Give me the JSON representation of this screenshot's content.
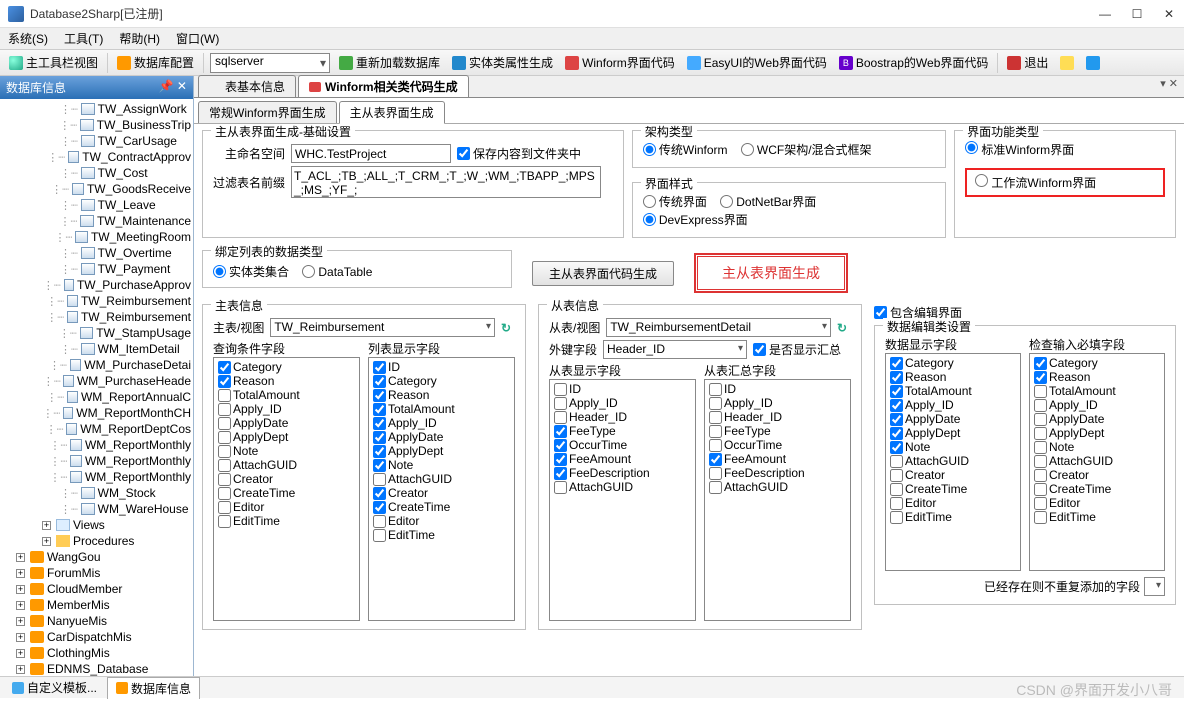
{
  "window": {
    "title": "Database2Sharp[已注册]"
  },
  "menu": {
    "system": "系统(S)",
    "tools": "工具(T)",
    "help": "帮助(H)",
    "window": "窗口(W)"
  },
  "toolbar": {
    "main_toolbar": "主工具栏视图",
    "db_config": "数据库配置",
    "db_select": "sqlserver",
    "reload": "重新加载数据库",
    "entity_attr": "实体类属性生成",
    "winform_code": "Winform界面代码",
    "easyui": "EasyUI的Web界面代码",
    "bootstrap": "Boostrap的Web界面代码",
    "exit": "退出"
  },
  "left": {
    "title": "数据库信息",
    "tables": [
      "TW_AssignWork",
      "TW_BusinessTrip",
      "TW_CarUsage",
      "TW_ContractApprov",
      "TW_Cost",
      "TW_GoodsReceive",
      "TW_Leave",
      "TW_Maintenance",
      "TW_MeetingRoom",
      "TW_Overtime",
      "TW_Payment",
      "TW_PurchaseApprov",
      "TW_Reimbursement",
      "TW_Reimbursement",
      "TW_StampUsage",
      "WM_ItemDetail",
      "WM_PurchaseDetai",
      "WM_PurchaseHeade",
      "WM_ReportAnnualC",
      "WM_ReportMonthCH",
      "WM_ReportDeptCos",
      "WM_ReportMonthly",
      "WM_ReportMonthly",
      "WM_ReportMonthly",
      "WM_Stock",
      "WM_WareHouse"
    ],
    "views": "Views",
    "procedures": "Procedures",
    "dbs": [
      "WangGou",
      "ForumMis",
      "CloudMember",
      "MemberMis",
      "NanyueMis",
      "CarDispatchMis",
      "ClothingMis",
      "EDNMS_Database"
    ]
  },
  "tabs": {
    "t1": "表基本信息",
    "t2": "Winform相关类代码生成",
    "inner1": "常规Winform界面生成",
    "inner2": "主从表界面生成"
  },
  "basic": {
    "legend": "主从表界面生成-基础设置",
    "ns_label": "主命名空间",
    "ns_value": "WHC.TestProject",
    "save_chk": "保存内容到文件夹中",
    "prefix_label": "过滤表名前缀",
    "prefix_value": "T_ACL_;TB_;ALL_;T_CRM_;T_;W_;WM_;TBAPP_;MPS_;MS_;YF_;"
  },
  "arch": {
    "legend": "架构类型",
    "r1": "传统Winform",
    "r2": "WCF架构/混合式框架"
  },
  "style": {
    "legend": "界面样式",
    "r1": "传统界面",
    "r2": "DotNetBar界面",
    "r3": "DevExpress界面"
  },
  "fntype": {
    "legend": "界面功能类型",
    "r1": "标准Winform界面",
    "r2": "工作流Winform界面"
  },
  "bind": {
    "legend": "绑定列表的数据类型",
    "r1": "实体类集合",
    "r2": "DataTable"
  },
  "btns": {
    "gen1": "主从表界面代码生成",
    "gen2": "主从表界面生成"
  },
  "master": {
    "legend": "主表信息",
    "view_label": "主表/视图",
    "view_value": "TW_Reimbursement",
    "q_legend": "查询条件字段",
    "d_legend": "列表显示字段",
    "query_fields": [
      {
        "l": "Category",
        "c": true
      },
      {
        "l": "Reason",
        "c": true
      },
      {
        "l": "TotalAmount",
        "c": false
      },
      {
        "l": "Apply_ID",
        "c": false
      },
      {
        "l": "ApplyDate",
        "c": false
      },
      {
        "l": "ApplyDept",
        "c": false
      },
      {
        "l": "Note",
        "c": false
      },
      {
        "l": "AttachGUID",
        "c": false
      },
      {
        "l": "Creator",
        "c": false
      },
      {
        "l": "CreateTime",
        "c": false
      },
      {
        "l": "Editor",
        "c": false
      },
      {
        "l": "EditTime",
        "c": false
      }
    ],
    "disp_fields": [
      {
        "l": "ID",
        "c": true
      },
      {
        "l": "Category",
        "c": true
      },
      {
        "l": "Reason",
        "c": true
      },
      {
        "l": "TotalAmount",
        "c": true
      },
      {
        "l": "Apply_ID",
        "c": true
      },
      {
        "l": "ApplyDate",
        "c": true
      },
      {
        "l": "ApplyDept",
        "c": true
      },
      {
        "l": "Note",
        "c": true
      },
      {
        "l": "AttachGUID",
        "c": false
      },
      {
        "l": "Creator",
        "c": true
      },
      {
        "l": "CreateTime",
        "c": true
      },
      {
        "l": "Editor",
        "c": false
      },
      {
        "l": "EditTime",
        "c": false
      }
    ]
  },
  "detail": {
    "legend": "从表信息",
    "view_label": "从表/视图",
    "view_value": "TW_ReimbursementDetail",
    "fk_label": "外键字段",
    "fk_value": "Header_ID",
    "show_sum": "是否显示汇总",
    "d_legend": "从表显示字段",
    "s_legend": "从表汇总字段",
    "disp_fields": [
      {
        "l": "ID",
        "c": false
      },
      {
        "l": "Apply_ID",
        "c": false
      },
      {
        "l": "Header_ID",
        "c": false
      },
      {
        "l": "FeeType",
        "c": true
      },
      {
        "l": "OccurTime",
        "c": true
      },
      {
        "l": "FeeAmount",
        "c": true
      },
      {
        "l": "FeeDescription",
        "c": true
      },
      {
        "l": "AttachGUID",
        "c": false
      }
    ],
    "sum_fields": [
      {
        "l": "ID",
        "c": false
      },
      {
        "l": "Apply_ID",
        "c": false
      },
      {
        "l": "Header_ID",
        "c": false
      },
      {
        "l": "FeeType",
        "c": false
      },
      {
        "l": "OccurTime",
        "c": false
      },
      {
        "l": "FeeAmount",
        "c": true
      },
      {
        "l": "FeeDescription",
        "c": false
      },
      {
        "l": "AttachGUID",
        "c": false
      }
    ]
  },
  "edit": {
    "chk": "包含编辑界面",
    "legend": "数据编辑类设置",
    "d_legend": "数据显示字段",
    "r_legend": "检查输入必填字段",
    "disp_fields": [
      {
        "l": "Category",
        "c": true
      },
      {
        "l": "Reason",
        "c": true
      },
      {
        "l": "TotalAmount",
        "c": true
      },
      {
        "l": "Apply_ID",
        "c": true
      },
      {
        "l": "ApplyDate",
        "c": true
      },
      {
        "l": "ApplyDept",
        "c": true
      },
      {
        "l": "Note",
        "c": true
      },
      {
        "l": "AttachGUID",
        "c": false
      },
      {
        "l": "Creator",
        "c": false
      },
      {
        "l": "CreateTime",
        "c": false
      },
      {
        "l": "Editor",
        "c": false
      },
      {
        "l": "EditTime",
        "c": false
      }
    ],
    "req_fields": [
      {
        "l": "Category",
        "c": true
      },
      {
        "l": "Reason",
        "c": true
      },
      {
        "l": "TotalAmount",
        "c": false
      },
      {
        "l": "Apply_ID",
        "c": false
      },
      {
        "l": "ApplyDate",
        "c": false
      },
      {
        "l": "ApplyDept",
        "c": false
      },
      {
        "l": "Note",
        "c": false
      },
      {
        "l": "AttachGUID",
        "c": false
      },
      {
        "l": "Creator",
        "c": false
      },
      {
        "l": "CreateTime",
        "c": false
      },
      {
        "l": "Editor",
        "c": false
      },
      {
        "l": "EditTime",
        "c": false
      }
    ],
    "no_dup": "已经存在则不重复添加的字段"
  },
  "bottom": {
    "t1": "自定义模板...",
    "t2": "数据库信息"
  },
  "watermark": "CSDN @界面开发小八哥"
}
